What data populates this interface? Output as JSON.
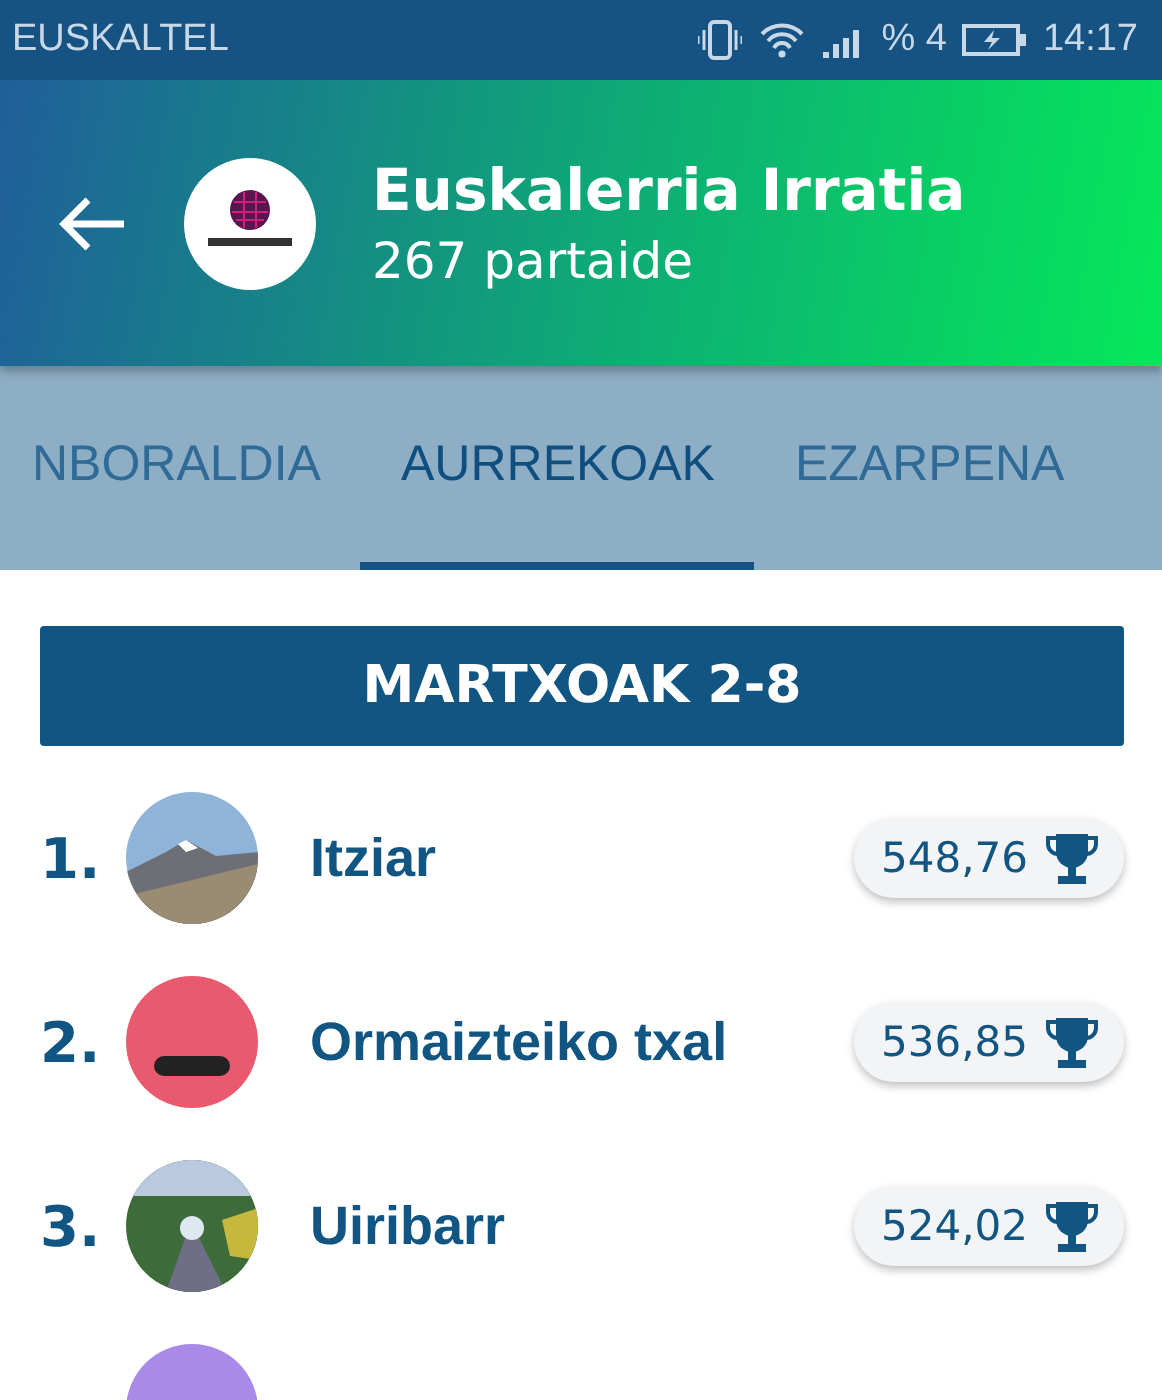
{
  "status_bar": {
    "carrier": "EUSKALTEL",
    "battery_text": "% 4",
    "time": "14:17"
  },
  "header": {
    "title": "Euskalerria Irratia",
    "subtitle": "267 partaide"
  },
  "tabs": [
    {
      "label": "NBORALDIA",
      "selected": false
    },
    {
      "label": "AURREKOAK",
      "selected": true
    },
    {
      "label": "EZARPENA",
      "selected": false
    }
  ],
  "week_banner": "MARTXOAK 2-8",
  "ranking": [
    {
      "rank": "1.",
      "name": "Itziar",
      "points": "548,76"
    },
    {
      "rank": "2.",
      "name": "Ormaizteiko txal",
      "points": "536,85"
    },
    {
      "rank": "3.",
      "name": "Uiribarr",
      "points": "524,02"
    }
  ]
}
